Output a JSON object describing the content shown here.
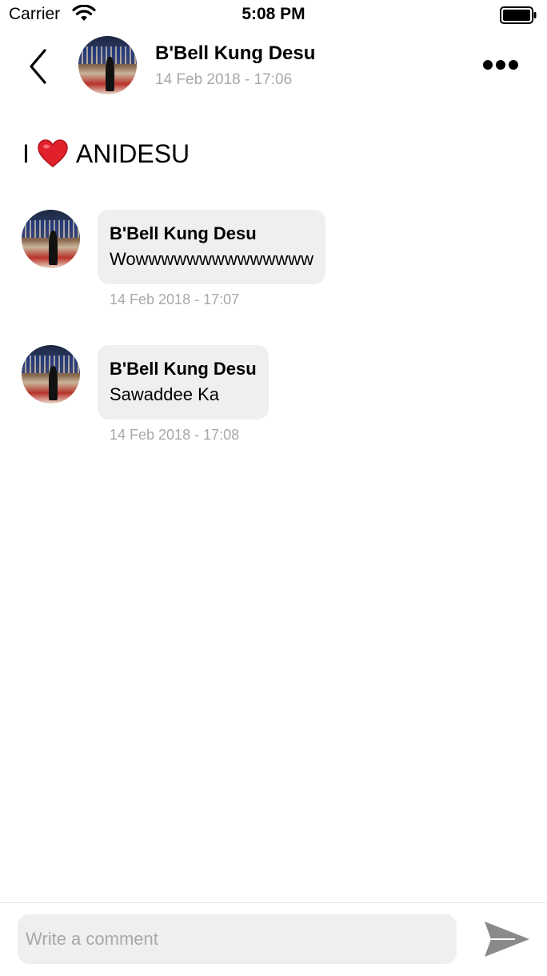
{
  "status_bar": {
    "carrier": "Carrier",
    "time": "5:08 PM",
    "icons": [
      "wifi-icon",
      "battery-icon"
    ]
  },
  "header": {
    "back_icon": "chevron-left-icon",
    "author_name": "B'Bell Kung Desu",
    "post_time": "14 Feb 2018 - 17:06",
    "more_icon": "ellipsis-icon"
  },
  "post": {
    "text_before": "I",
    "emoji_icon": "heart-icon",
    "emoji_color": "#e0202a",
    "text_after": "ANIDESU"
  },
  "comments": [
    {
      "name": "B'Bell Kung Desu",
      "text": "Wowwwwwwwwwwwwww",
      "time": "14 Feb 2018 - 17:07"
    },
    {
      "name": "B'Bell Kung Desu",
      "text": "Sawaddee Ka",
      "time": "14 Feb 2018 - 17:08"
    }
  ],
  "composer": {
    "placeholder": "Write a comment",
    "value": "",
    "send_icon": "send-icon",
    "send_color": "#8a8a8a"
  },
  "colors": {
    "bubble_bg": "#efefef",
    "meta_text": "#a8a8a8"
  }
}
